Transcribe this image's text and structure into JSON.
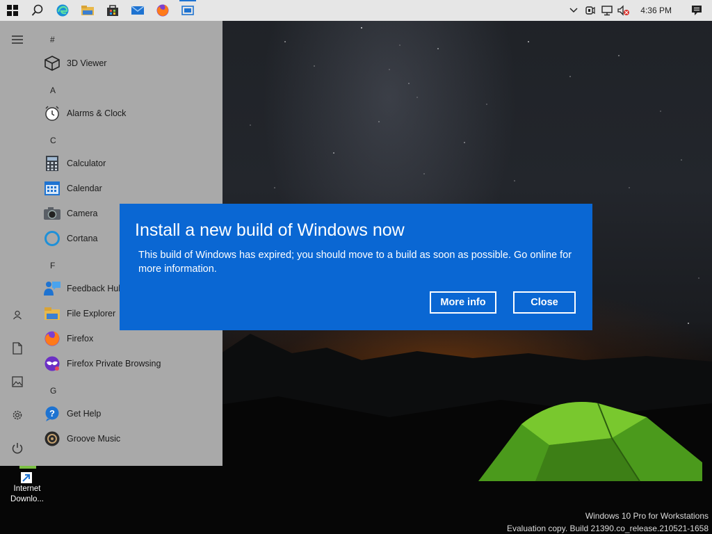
{
  "taskbar": {
    "buttons": [
      {
        "icon": "windows-start-icon"
      },
      {
        "icon": "search-icon"
      },
      {
        "icon": "edge-icon"
      },
      {
        "icon": "file-explorer-icon"
      },
      {
        "icon": "store-icon"
      },
      {
        "icon": "mail-icon"
      },
      {
        "icon": "firefox-icon"
      },
      {
        "icon": "tablet-window-icon"
      }
    ],
    "tray": {
      "icons": [
        "chevron-up-icon",
        "meet-now-icon",
        "network-icon",
        "volume-muted-icon"
      ],
      "time": "4:36 PM",
      "notification_icon": "action-center-icon"
    }
  },
  "start_menu": {
    "rail": [
      "hamburger-icon",
      "user-icon",
      "documents-icon",
      "pictures-icon",
      "settings-icon",
      "power-icon"
    ],
    "groups": [
      {
        "letter": "#",
        "apps": [
          {
            "label": "3D Viewer",
            "icon": "cube-icon"
          }
        ]
      },
      {
        "letter": "A",
        "apps": [
          {
            "label": "Alarms & Clock",
            "icon": "alarm-clock-icon"
          }
        ]
      },
      {
        "letter": "C",
        "apps": [
          {
            "label": "Calculator",
            "icon": "calculator-icon"
          },
          {
            "label": "Calendar",
            "icon": "calendar-icon"
          },
          {
            "label": "Camera",
            "icon": "camera-icon"
          },
          {
            "label": "Cortana",
            "icon": "cortana-icon"
          }
        ]
      },
      {
        "letter": "F",
        "apps": [
          {
            "label": "Feedback Hub",
            "icon": "feedback-hub-icon"
          },
          {
            "label": "File Explorer",
            "icon": "folder-icon"
          },
          {
            "label": "Firefox",
            "icon": "firefox-icon"
          },
          {
            "label": "Firefox Private Browsing",
            "icon": "firefox-private-icon"
          }
        ]
      },
      {
        "letter": "G",
        "apps": [
          {
            "label": "Get Help",
            "icon": "get-help-icon"
          },
          {
            "label": "Groove Music",
            "icon": "groove-music-icon"
          }
        ]
      }
    ]
  },
  "dialog": {
    "title": "Install a new build of Windows now",
    "body": "This build of Windows has expired; you should move to a build as soon as possible. Go online for more information.",
    "more_info_label": "More info",
    "close_label": "Close",
    "color": "#0a67d3"
  },
  "desktop": {
    "icon_label_line1": "Internet",
    "icon_label_line2": "Downlo..."
  },
  "watermark": {
    "line1": "Windows 10 Pro for Workstations",
    "line2": "Evaluation copy. Build 21390.co_release.210521-1658"
  }
}
